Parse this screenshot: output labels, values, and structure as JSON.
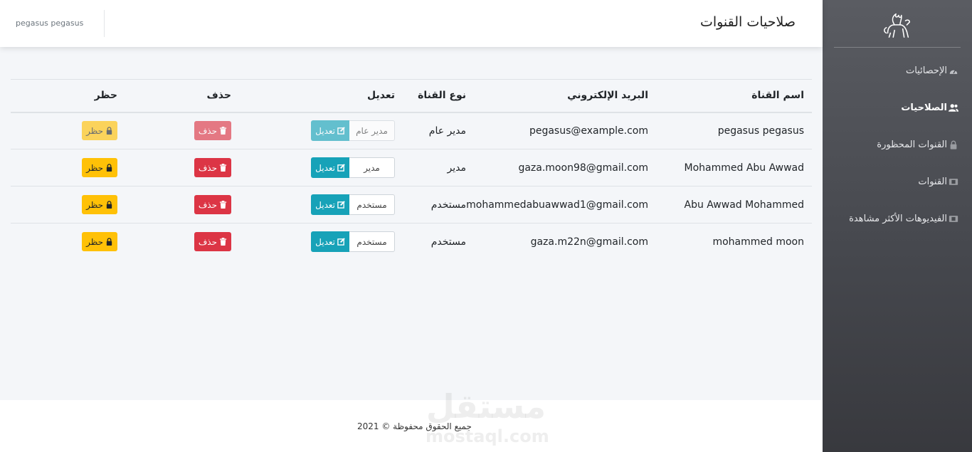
{
  "header": {
    "title": "صلاحيات القنوات",
    "user": "pegasus pegasus"
  },
  "sidebar": {
    "logo_icon": "pegasus-logo-icon",
    "items": [
      {
        "label": "الإحصائيات",
        "icon": "speedometer-icon",
        "active": false
      },
      {
        "label": "الصلاحيات",
        "icon": "users-icon",
        "active": true
      },
      {
        "label": "القنوات المحظورة",
        "icon": "lock-icon",
        "active": false
      },
      {
        "label": "القنوات",
        "icon": "film-icon",
        "active": false
      },
      {
        "label": "الفيديوهات الأكثر مشاهدة",
        "icon": "film-icon",
        "active": false
      }
    ]
  },
  "table": {
    "headers": {
      "name": "اسم القناة",
      "email": "البريد الإلكتروني",
      "type": "نوع القناة",
      "edit": "تعديل",
      "delete": "حذف",
      "ban": "حظر"
    },
    "rows": [
      {
        "name": "pegasus pegasus",
        "email": "pegasus@example.com",
        "type": "مدير عام",
        "select": "مدير عام",
        "edit_label": "تعديل",
        "delete_label": "حذف",
        "ban_label": "حظر",
        "disabled": true
      },
      {
        "name": "Mohammed Abu Awwad",
        "email": "gaza.moon98@gmail.com",
        "type": "مدير",
        "select": "مدير",
        "edit_label": "تعديل",
        "delete_label": "حذف",
        "ban_label": "حظر",
        "disabled": false
      },
      {
        "name": "Abu Awwad Mohammed",
        "email": "mohammedabuawwad1@gmail.com",
        "type": "مستخدم",
        "select": "مستخدم",
        "edit_label": "تعديل",
        "delete_label": "حذف",
        "ban_label": "حظر",
        "disabled": false
      },
      {
        "name": "mohammed moon",
        "email": "gaza.m22n@gmail.com",
        "type": "مستخدم",
        "select": "مستخدم",
        "edit_label": "تعديل",
        "delete_label": "حذف",
        "ban_label": "حظر",
        "disabled": false
      }
    ]
  },
  "footer": {
    "copyright": "جميع الحقوق محفوظة © 2021",
    "watermark_ar": "مستقل",
    "watermark_en": "mostaql.com"
  },
  "colors": {
    "edit": "#17a2b8",
    "delete": "#dc3545",
    "ban": "#ffc107",
    "sidebar": "#46484e"
  }
}
